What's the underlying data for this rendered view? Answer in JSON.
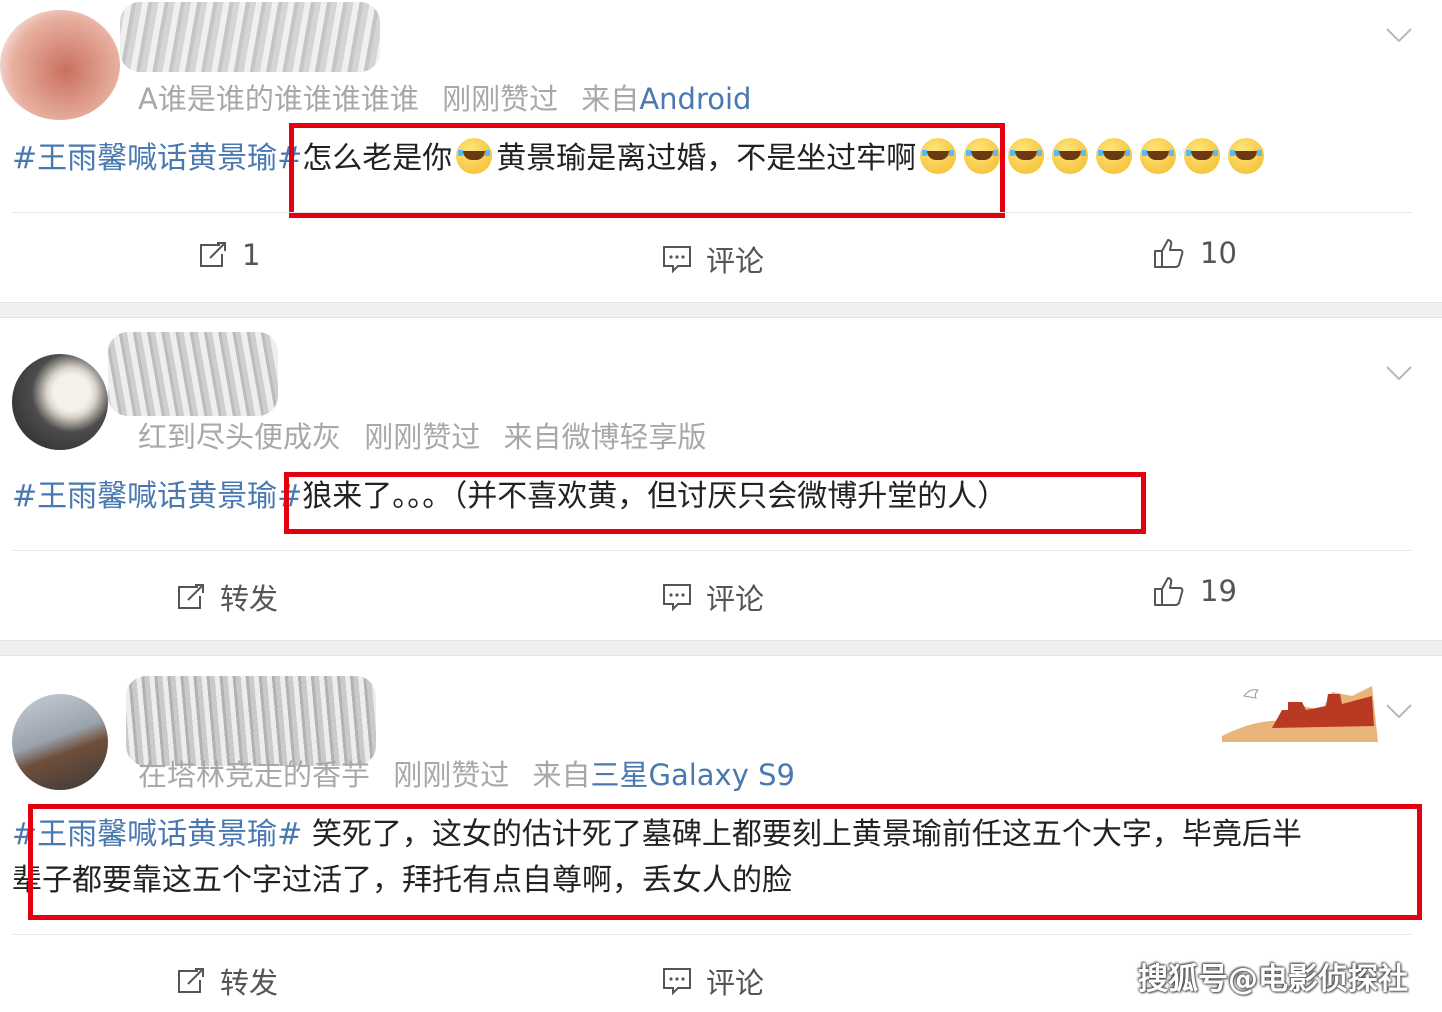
{
  "posts": [
    {
      "username": "A谁是谁的谁谁谁谁谁",
      "liked_label": "刚刚赞过",
      "source_prefix": "来自",
      "source": "Android",
      "topic": "#王雨馨喊话黄景瑜#",
      "text_a": "怎么老是你",
      "text_b": "黄景瑜是离过婚，不是坐过牢啊",
      "repost_label": "1",
      "comment_label": "评论",
      "like_count": "10"
    },
    {
      "username": "红到尽头便成灰",
      "liked_label": "刚刚赞过",
      "source_prefix": "来自微博轻享版",
      "source": "",
      "topic": "#王雨馨喊话黄景瑜#",
      "text_a": "狼来了。。。（并不喜欢黄，但讨厌只会微博升堂的人）",
      "repost_label": "转发",
      "comment_label": "评论",
      "like_count": "19"
    },
    {
      "username": "在塔林竞走的香芋",
      "liked_label": "刚刚赞过",
      "source_prefix": "来自",
      "source": "三星Galaxy S9",
      "topic": "#王雨馨喊话黄景瑜#",
      "text_line1": " 笑死了，这女的估计死了墓碑上都要刻上黄景瑜前任这五个大字，毕竟后半",
      "text_line2": "辈子都要靠这五个字过活了，拜托有点自尊啊，丢女人的脸",
      "repost_label": "转发",
      "comment_label": "评论"
    }
  ],
  "icons": {
    "chevron": "chevron-down-icon",
    "repost": "repost-icon",
    "comment": "comment-icon",
    "like": "thumbs-up-icon",
    "emoji": "laugh-cry-emoji"
  },
  "colors": {
    "link": "#4a78b0",
    "highlight_box": "#e3000f",
    "meta": "#a8a8a8"
  },
  "watermark": "搜狐号@电影侦探社"
}
